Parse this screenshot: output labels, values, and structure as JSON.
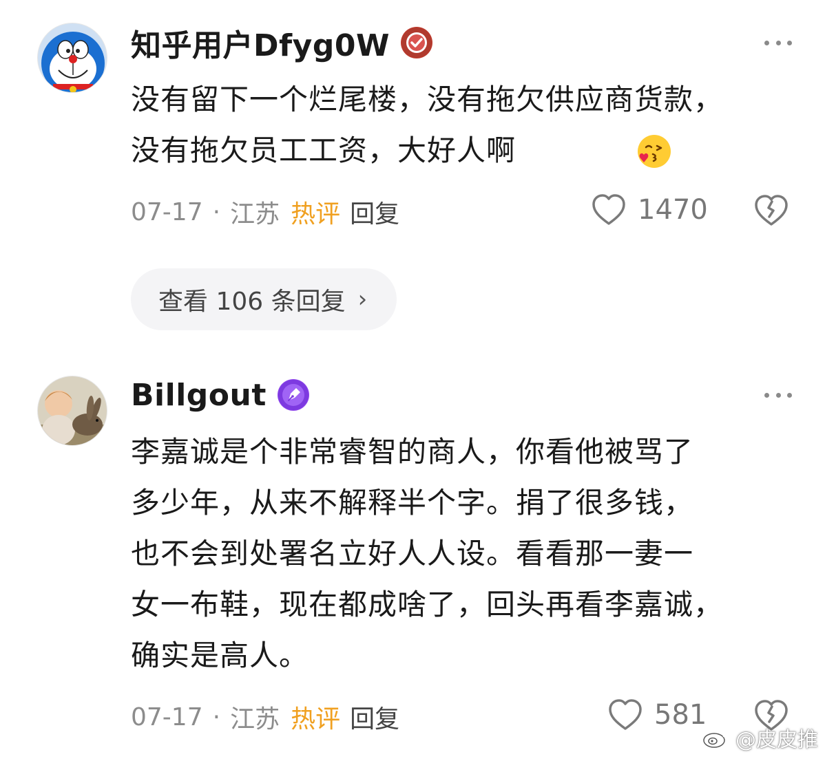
{
  "comments": [
    {
      "username": "知乎用户Dfyg0W",
      "avatar_icon": "doraemon-avatar",
      "badge_icon": "verified-check-icon",
      "badge_color": "#c0392b",
      "text_lines": [
        "没有留下一个烂尾楼，没有拖欠供应商货款，",
        "没有拖欠员工工资，大好人啊"
      ],
      "emoji": "kissing-face-emoji",
      "date": "07-17",
      "separator": "·",
      "location": "江苏",
      "hot_label": "热评",
      "reply_label": "回复",
      "likes": "1470",
      "view_replies_label": "查看 106 条回复",
      "view_replies_chevron": "›"
    },
    {
      "username": "Billgout",
      "avatar_icon": "child-with-rabbit-avatar",
      "badge_icon": "pen-nib-icon",
      "badge_color": "#8e44ec",
      "text_lines": [
        "李嘉诚是个非常睿智的商人，你看他被骂了",
        "多少年，从来不解释半个字。捐了很多钱，",
        "也不会到处署名立好人人设。看看那一妻一",
        "女一布鞋，现在都成啥了，回头再看李嘉诚，",
        "确实是高人。"
      ],
      "date": "07-17",
      "separator": "·",
      "location": "江苏",
      "hot_label": "热评",
      "reply_label": "回复",
      "likes": "581"
    }
  ],
  "watermark": {
    "icon": "weibo-logo-icon",
    "text": "@皮皮推"
  },
  "colors": {
    "hot_label": "#f0a020",
    "meta_gray": "#8c8c8c",
    "pill_bg": "#f4f4f6"
  }
}
